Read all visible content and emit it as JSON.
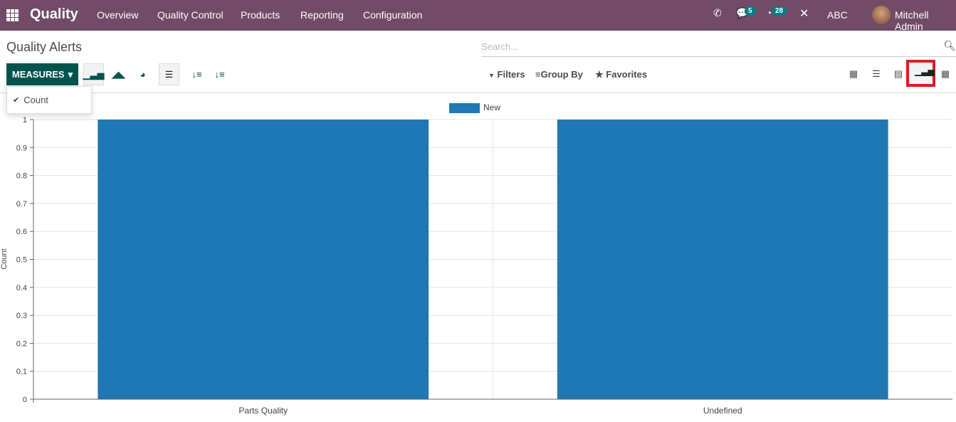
{
  "navbar": {
    "app": "Quality",
    "menu": [
      "Overview",
      "Quality Control",
      "Products",
      "Reporting",
      "Configuration"
    ],
    "messages_count": "5",
    "activities_count": "28",
    "company": "ABC",
    "user": "Mitchell Admin"
  },
  "page": {
    "title": "Quality Alerts",
    "search_placeholder": "Search..."
  },
  "toolbar": {
    "measures": "MEASURES",
    "filters": "Filters",
    "group_by": "Group By",
    "favorites": "Favorites",
    "active_view": "graph",
    "active_chart": "bar"
  },
  "measures_dropdown": {
    "items": [
      {
        "label": "Count",
        "checked": true
      }
    ]
  },
  "chart_data": {
    "type": "bar",
    "categories": [
      "Parts Quality",
      "Undefined"
    ],
    "series": [
      {
        "name": "New",
        "values": [
          1,
          1
        ],
        "color": "#1f77b4"
      }
    ],
    "ylabel": "Count",
    "xlabel": "",
    "ylim": [
      0,
      1
    ],
    "yticks": [
      "0",
      "0.1",
      "0.2",
      "0.3",
      "0.4",
      "0.5",
      "0.6",
      "0.7",
      "0.8",
      "0.9",
      "1"
    ],
    "grid": true,
    "legend": "top"
  }
}
